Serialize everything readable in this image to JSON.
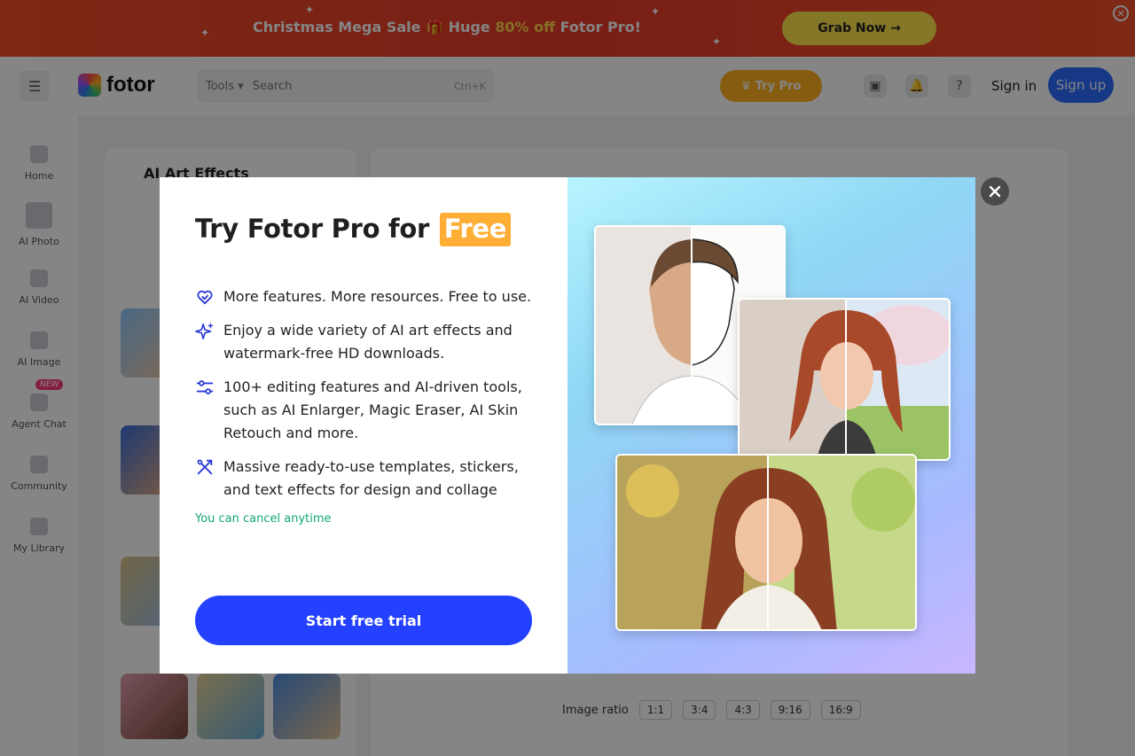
{
  "promo": {
    "text_prefix": "Christmas Mega Sale",
    "text_mid": "Huge ",
    "text_highlight": "80% off",
    "text_suffix": " Fotor Pro!",
    "button_label": "Grab Now →"
  },
  "nav": {
    "brand": "fotor",
    "search_scope": "Tools ▾",
    "search_placeholder": "Search",
    "search_shortcut": "Ctrl+K",
    "try_pro_label": "Try Pro",
    "signin_label": "Sign in",
    "signup_label": "Sign up"
  },
  "rail": {
    "items": [
      {
        "label": "Home"
      },
      {
        "label": "AI Photo"
      },
      {
        "label": "AI Video"
      },
      {
        "label": "AI Image"
      },
      {
        "label": "Agent Chat"
      },
      {
        "label": "Community"
      },
      {
        "label": "My Library"
      }
    ],
    "badge": "NEW"
  },
  "panel": {
    "title": "AI Art Effects"
  },
  "canvas": {
    "ratio_label": "Image ratio",
    "ratios": [
      "1:1",
      "3:4",
      "4:3",
      "9:16",
      "16:9"
    ]
  },
  "modal": {
    "title_prefix": "Try Fotor Pro for ",
    "title_badge": "Free",
    "features": [
      {
        "icon": "heart-arrow-icon",
        "text": "More features. More resources. Free to use."
      },
      {
        "icon": "sparkle-icon",
        "text": "Enjoy a wide variety of AI art effects and watermark-free HD downloads."
      },
      {
        "icon": "sliders-icon",
        "text": "100+ editing features and AI-driven tools, such as AI Enlarger, Magic Eraser, AI Skin Retouch and more."
      },
      {
        "icon": "tools-icon",
        "text": "Massive ready-to-use templates, stickers, and text effects for design and collage"
      }
    ],
    "cancel_note": "You can cancel anytime",
    "cta_label": "Start free trial",
    "close_icon": "close-icon"
  },
  "colors": {
    "accent_blue": "#2441ff",
    "badge_orange": "#ffae35",
    "note_green": "#12a579",
    "promo_red": "#e83a2a"
  }
}
